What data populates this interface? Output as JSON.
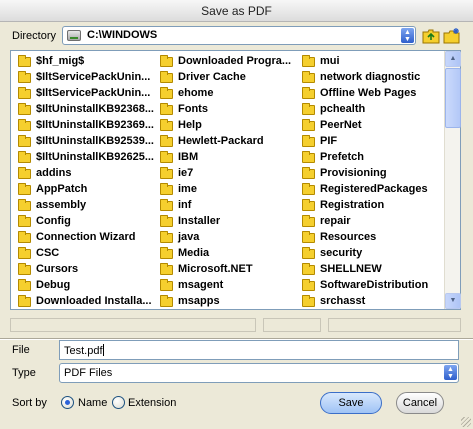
{
  "window": {
    "title": "Save as PDF"
  },
  "directory": {
    "label": "Directory",
    "value": "C:\\WINDOWS"
  },
  "toolbar": {
    "up_icon": "folder-up-icon",
    "new_folder_icon": "new-folder-icon"
  },
  "files": {
    "columns": [
      [
        "$hf_mig$",
        "$IltServicePackUnin...",
        "$IltServicePackUnin...",
        "$IltUninstallKB92368...",
        "$IltUninstallKB92369...",
        "$IltUninstallKB92539...",
        "$IltUninstallKB92625...",
        "addins",
        "AppPatch",
        "assembly",
        "Config",
        "Connection Wizard",
        "CSC",
        "Cursors",
        "Debug",
        "Downloaded Installa..."
      ],
      [
        "Downloaded Progra...",
        "Driver Cache",
        "ehome",
        "Fonts",
        "Help",
        "Hewlett-Packard",
        "IBM",
        "ie7",
        "ime",
        "inf",
        "Installer",
        "java",
        "Media",
        "Microsoft.NET",
        "msagent",
        "msapps"
      ],
      [
        "mui",
        "network diagnostic",
        "Offline Web Pages",
        "pchealth",
        "PeerNet",
        "PIF",
        "Prefetch",
        "Provisioning",
        "RegisteredPackages",
        "Registration",
        "repair",
        "Resources",
        "security",
        "SHELLNEW",
        "SoftwareDistribution",
        "srchasst"
      ]
    ]
  },
  "file": {
    "label": "File",
    "value": "Test.pdf"
  },
  "type": {
    "label": "Type",
    "value": "PDF Files"
  },
  "sort": {
    "label": "Sort by",
    "options": [
      "Name",
      "Extension"
    ],
    "selected": "Name"
  },
  "buttons": {
    "save": "Save",
    "cancel": "Cancel"
  }
}
